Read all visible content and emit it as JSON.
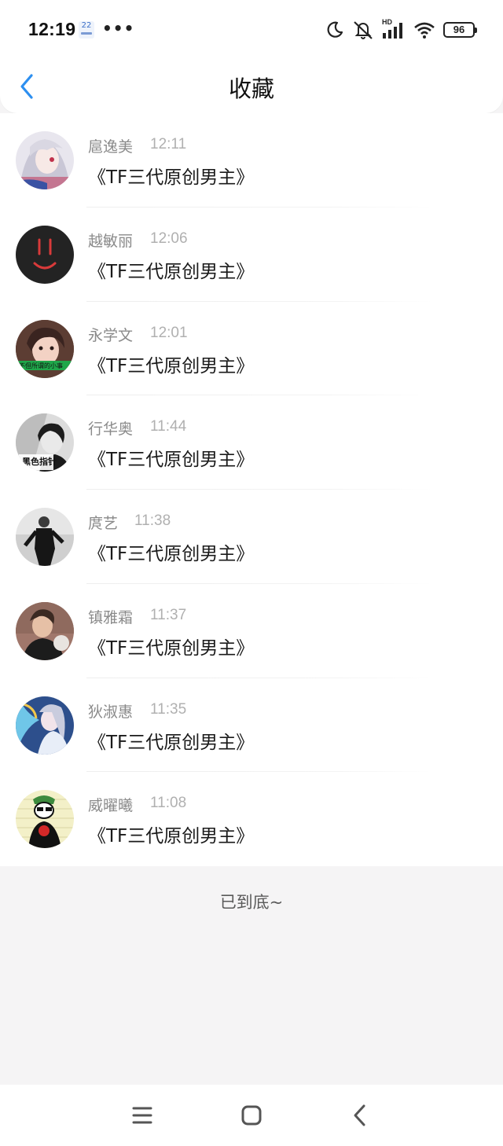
{
  "status_bar": {
    "time": "12:19",
    "calendar_day": "22",
    "more_dots": "•••",
    "hd_label": "HD",
    "battery": "96"
  },
  "nav": {
    "title": "收藏",
    "back_icon": "chevron-left-icon",
    "accent_color": "#2d8ff0"
  },
  "items": [
    {
      "name": "扈逸美",
      "time": "12:11",
      "title": "《TF三代原创男主》",
      "avatar": "anime-girl-silver-hair"
    },
    {
      "name": "越敏丽",
      "time": "12:06",
      "title": "《TF三代原创男主》",
      "avatar": "red-smiley-on-black"
    },
    {
      "name": "永学文",
      "time": "12:01",
      "title": "《TF三代原创男主》",
      "avatar": "girl-portrait-green-banner",
      "avatar_caption": "不但所谓的小事"
    },
    {
      "name": "行华奥",
      "time": "11:44",
      "title": "《TF三代原创男主》",
      "avatar": "bw-man-portrait",
      "avatar_caption": "黑色指针"
    },
    {
      "name": "庹艺",
      "time": "11:38",
      "title": "《TF三代原创男主》",
      "avatar": "bw-man-standing"
    },
    {
      "name": "镇雅霜",
      "time": "11:37",
      "title": "《TF三代原创男主》",
      "avatar": "young-man-photo"
    },
    {
      "name": "狄淑惠",
      "time": "11:35",
      "title": "《TF三代原创男主》",
      "avatar": "anime-girl-blue-dragon"
    },
    {
      "name": "威曜曦",
      "time": "11:08",
      "title": "《TF三代原创男主》",
      "avatar": "cartoon-man-red-flower"
    }
  ],
  "end_text": "已到底~",
  "system_nav": {
    "menu_icon": "menu-icon",
    "home_icon": "home-icon",
    "back_icon": "back-icon"
  }
}
